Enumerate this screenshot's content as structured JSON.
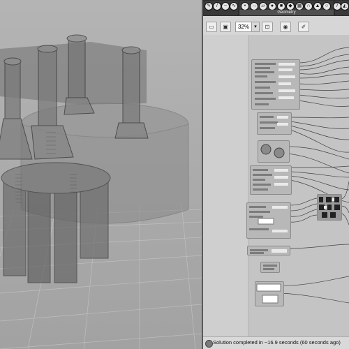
{
  "ribbon": {
    "groups": [
      {
        "label": "",
        "icons": [
          "pen-icon",
          "line-icon",
          "curve-icon",
          "nurbs-icon"
        ]
      },
      {
        "label": "Geometry",
        "icons": [
          "point-icon",
          "vector-icon",
          "plane-icon",
          "sphere-icon",
          "box-icon",
          "brep-icon",
          "mesh-icon",
          "surface-icon",
          "cone-icon",
          "circle-icon"
        ]
      },
      {
        "label": "",
        "icons": [
          "numeric-icon",
          "triangle-icon"
        ]
      }
    ]
  },
  "toolbar": {
    "zoom_value": "32%",
    "zoom_dropdown_glyph": "▾"
  },
  "status": {
    "text": "Solution completed in ~16.9 seconds (60 seconds ago)"
  },
  "colors": {
    "viewport_bg": "#a9a9a9",
    "canvas_bg": "#c4c4c4",
    "node_fill": "#b8b8b8",
    "wire": "#2a2a2a"
  }
}
